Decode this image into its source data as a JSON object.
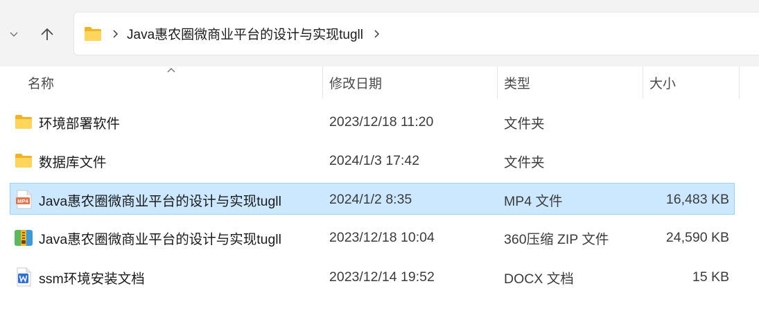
{
  "address": {
    "path": "Java惠农圈微商业平台的设计与实现tugll"
  },
  "columns": {
    "name": "名称",
    "date": "修改日期",
    "type": "类型",
    "size": "大小"
  },
  "rows": [
    {
      "name": "环境部署软件",
      "date": "2023/12/18 11:20",
      "type": "文件夹",
      "size": "",
      "icon": "folder-icon"
    },
    {
      "name": "数据库文件",
      "date": "2024/1/3 17:42",
      "type": "文件夹",
      "size": "",
      "icon": "folder-icon"
    },
    {
      "name": "Java惠农圈微商业平台的设计与实现tugll",
      "date": "2024/1/2 8:35",
      "type": "MP4 文件",
      "size": "16,483 KB",
      "icon": "mp4-file-icon",
      "selected": true
    },
    {
      "name": "Java惠农圈微商业平台的设计与实现tugll",
      "date": "2023/12/18 10:04",
      "type": "360压缩 ZIP 文件",
      "size": "24,590 KB",
      "icon": "zip-archive-icon"
    },
    {
      "name": "ssm环境安装文档",
      "date": "2023/12/14 19:52",
      "type": "DOCX 文档",
      "size": "15 KB",
      "icon": "docx-file-icon"
    }
  ],
  "colors": {
    "selection_bg": "#cce8ff",
    "selection_border": "#99d1ff",
    "folder_yellow": "#ffc83d"
  }
}
